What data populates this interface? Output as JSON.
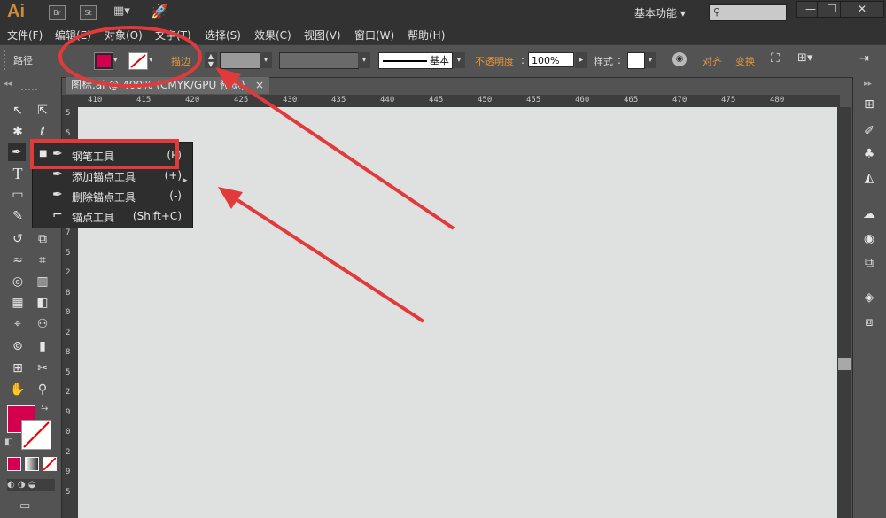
{
  "app": {
    "logo": "Ai"
  },
  "titlebar": {
    "icons": [
      "Br",
      "St"
    ],
    "workspace": "基本功能",
    "buttons": [
      "—",
      "❐",
      "✕"
    ]
  },
  "menubar": [
    "文件(F)",
    "编辑(E)",
    "对象(O)",
    "文字(T)",
    "选择(S)",
    "效果(C)",
    "视图(V)",
    "窗口(W)",
    "帮助(H)"
  ],
  "controlbar": {
    "path_label": "路径",
    "stroke_label": "描边",
    "stroke_style": "基本",
    "opacity_label": "不透明度",
    "opacity_value": "100%",
    "style_label": "样式",
    "align_label": "对齐",
    "transform_label": "变换",
    "fill_color": "#d4004f"
  },
  "document": {
    "tab_title": "图标.ai @ 400% (CMYK/GPU 预览)",
    "close": "×"
  },
  "hruler_ticks": [
    "410",
    "415",
    "420",
    "425",
    "430",
    "435",
    "440",
    "445",
    "450",
    "455",
    "460",
    "465",
    "470",
    "475",
    "480"
  ],
  "vruler_ticks": [
    "5",
    "5",
    "0",
    "7",
    "0",
    "2",
    "7",
    "5",
    "2",
    "8",
    "0",
    "2",
    "8",
    "5",
    "2",
    "9",
    "0",
    "2",
    "9",
    "5"
  ],
  "flyout": {
    "items": [
      {
        "label": "钢笔工具",
        "shortcut": "(P)",
        "icon": "pen-icon",
        "selected": true
      },
      {
        "label": "添加锚点工具",
        "shortcut": "(+)",
        "icon": "add-anchor-icon",
        "selected": false
      },
      {
        "label": "删除锚点工具",
        "shortcut": "(-)",
        "icon": "delete-anchor-icon",
        "selected": false
      },
      {
        "label": "锚点工具",
        "shortcut": "(Shift+C)",
        "icon": "anchor-point-icon",
        "selected": false
      }
    ]
  },
  "colors": {
    "fill": "#d4004f",
    "annotation": "#e23a3a",
    "accent": "#e7973b"
  }
}
